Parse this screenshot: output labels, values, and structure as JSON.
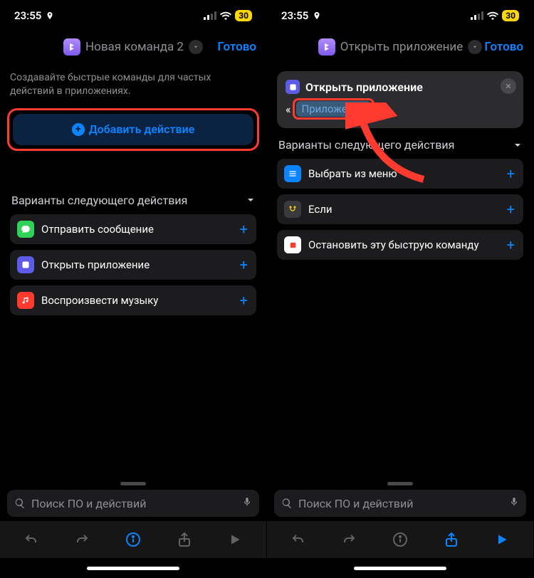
{
  "status": {
    "time": "23:55",
    "battery": "30"
  },
  "left": {
    "header_title": "Новая команда 2",
    "done": "Готово",
    "hint": "Создавайте быстрые команды для частых действий в приложениях.",
    "add_action": "Добавить действие",
    "section_title": "Варианты следующего действия",
    "suggestions": [
      {
        "label": "Отправить сообщение",
        "icon": "messages-icon",
        "color": "#30d158"
      },
      {
        "label": "Открыть приложение",
        "icon": "app-icon",
        "color": "#5e5ce6"
      },
      {
        "label": "Воспроизвести музыку",
        "icon": "music-icon",
        "color": "#ff3b30"
      }
    ]
  },
  "right": {
    "header_title": "Открыть приложение",
    "done": "Готово",
    "card_title": "Открыть приложение",
    "quote_open": "«",
    "quote_close": "»",
    "token": "Приложение",
    "section_title": "Варианты следующего действия",
    "suggestions": [
      {
        "label": "Выбрать из меню",
        "icon": "menu-icon",
        "color": "#0a84ff"
      },
      {
        "label": "Если",
        "icon": "branch-icon",
        "color": "#3a3a3c"
      },
      {
        "label": "Остановить эту быструю команду",
        "icon": "stop-icon",
        "color": "#ffffff"
      }
    ]
  },
  "search_placeholder": "Поиск ПО и действий"
}
